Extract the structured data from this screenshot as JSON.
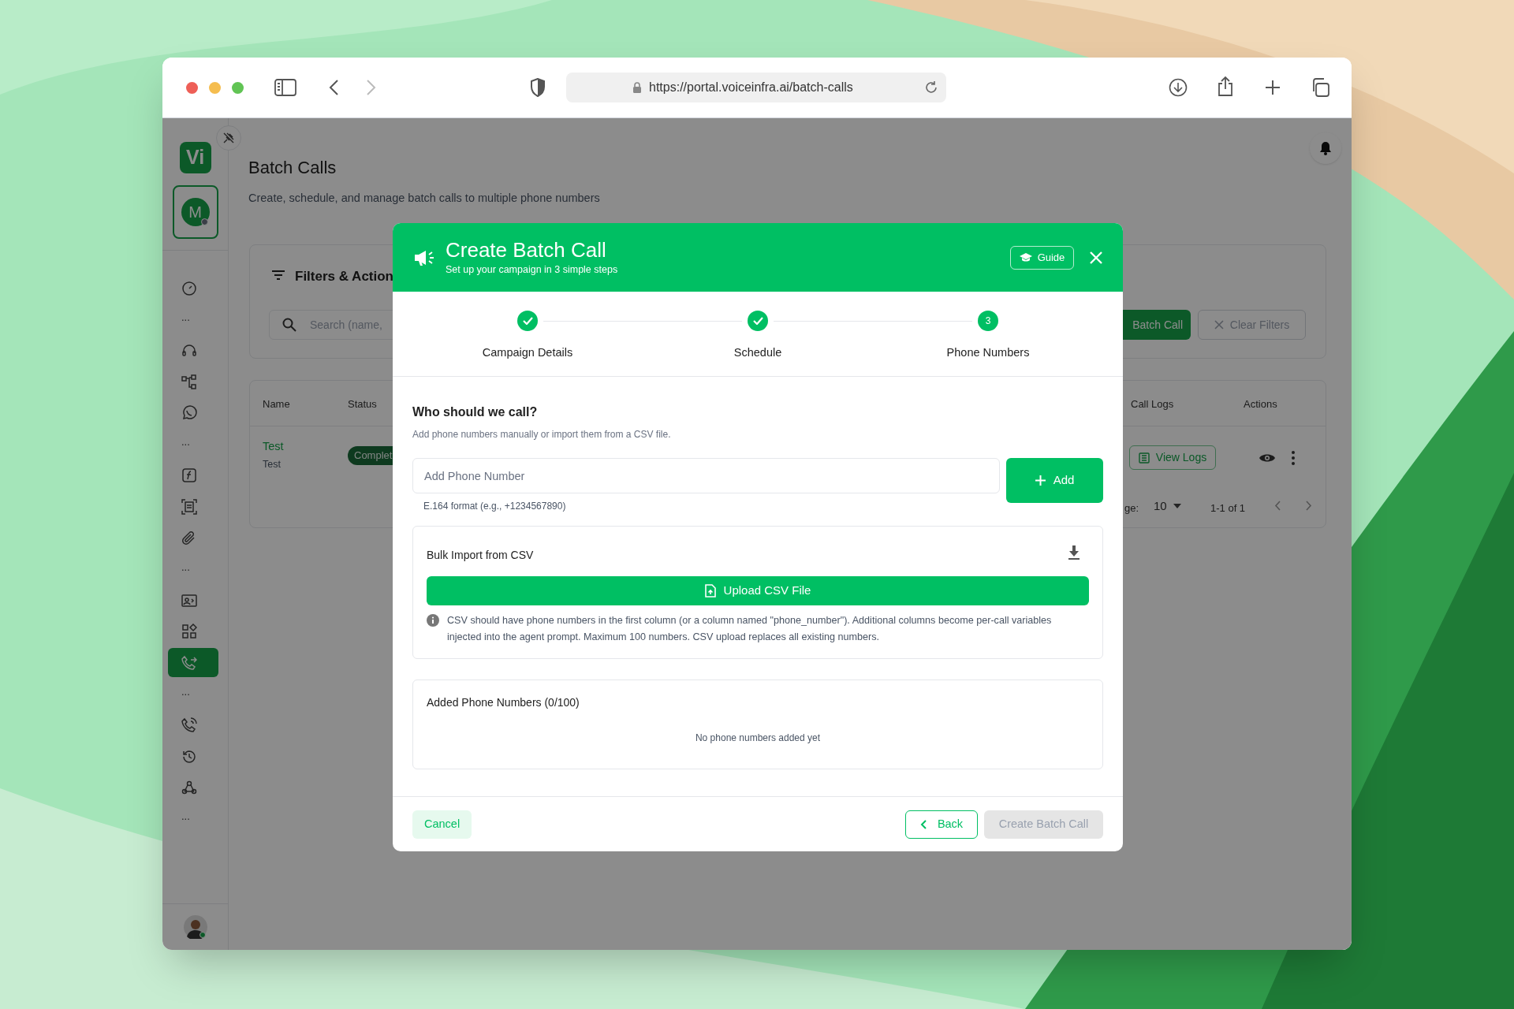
{
  "browser": {
    "url": "https://portal.voiceinfra.ai/batch-calls"
  },
  "sidebar": {
    "logo": "Vi",
    "account_initial": "M",
    "items": [
      {
        "kind": "icon",
        "selected": false
      },
      {
        "kind": "more",
        "text": "..."
      },
      {
        "kind": "icon",
        "selected": false
      },
      {
        "kind": "icon",
        "selected": false
      },
      {
        "kind": "icon",
        "selected": false
      },
      {
        "kind": "more",
        "text": "..."
      },
      {
        "kind": "icon",
        "selected": false
      },
      {
        "kind": "icon",
        "selected": false
      },
      {
        "kind": "icon",
        "selected": false
      },
      {
        "kind": "more",
        "text": "..."
      },
      {
        "kind": "icon",
        "selected": false
      },
      {
        "kind": "icon",
        "selected": false
      },
      {
        "kind": "icon",
        "selected": true
      },
      {
        "kind": "more",
        "text": "..."
      },
      {
        "kind": "icon",
        "selected": false
      },
      {
        "kind": "icon",
        "selected": false
      },
      {
        "kind": "icon",
        "selected": false
      },
      {
        "kind": "more",
        "text": "..."
      }
    ]
  },
  "page": {
    "title": "Batch Calls",
    "subtitle": "Create, schedule, and manage batch calls to multiple phone numbers",
    "filters": {
      "title": "Filters & Action",
      "search_placeholder": "Search (name,",
      "create_button": "Batch Call",
      "clear_button": "Clear Filters"
    },
    "table": {
      "columns": [
        {
          "label": "Name"
        },
        {
          "label": "Status"
        },
        {
          "label": "Call Logs"
        },
        {
          "label": "Actions"
        }
      ],
      "rows": [
        {
          "name": "Test",
          "description": "Test",
          "status": "Complet",
          "logs_button": "View Logs"
        }
      ],
      "pagination": {
        "rows_per_page_label": "ge:",
        "rows_per_page": "10",
        "range": "1-1 of 1"
      }
    }
  },
  "modal": {
    "title": "Create Batch Call",
    "subtitle": "Set up your campaign in 3 simple steps",
    "guide_button": "Guide",
    "steps": [
      {
        "label": "Campaign Details",
        "completed": true
      },
      {
        "label": "Schedule",
        "completed": true
      },
      {
        "label": "Phone Numbers",
        "number": "3",
        "completed": false
      }
    ],
    "section_title": "Who should we call?",
    "section_subtitle": "Add phone numbers manually or import them from a CSV file.",
    "phone_input": {
      "placeholder": "Add Phone Number",
      "hint": "E.164 format (e.g., +1234567890)"
    },
    "add_button": "Add",
    "bulk_import": {
      "title": "Bulk Import from CSV",
      "upload_button": "Upload CSV File",
      "info": "CSV should have phone numbers in the first column (or a column named \"phone_number\"). Additional columns become per-call variables injected into the agent prompt. Maximum 100 numbers. CSV upload replaces all existing numbers."
    },
    "added_numbers": {
      "title": "Added Phone Numbers (0/100)",
      "empty_text": "No phone numbers added yet"
    },
    "cancel_button": "Cancel",
    "back_button": "Back",
    "create_button": {
      "label": "Create Batch Call",
      "disabled": true
    }
  }
}
